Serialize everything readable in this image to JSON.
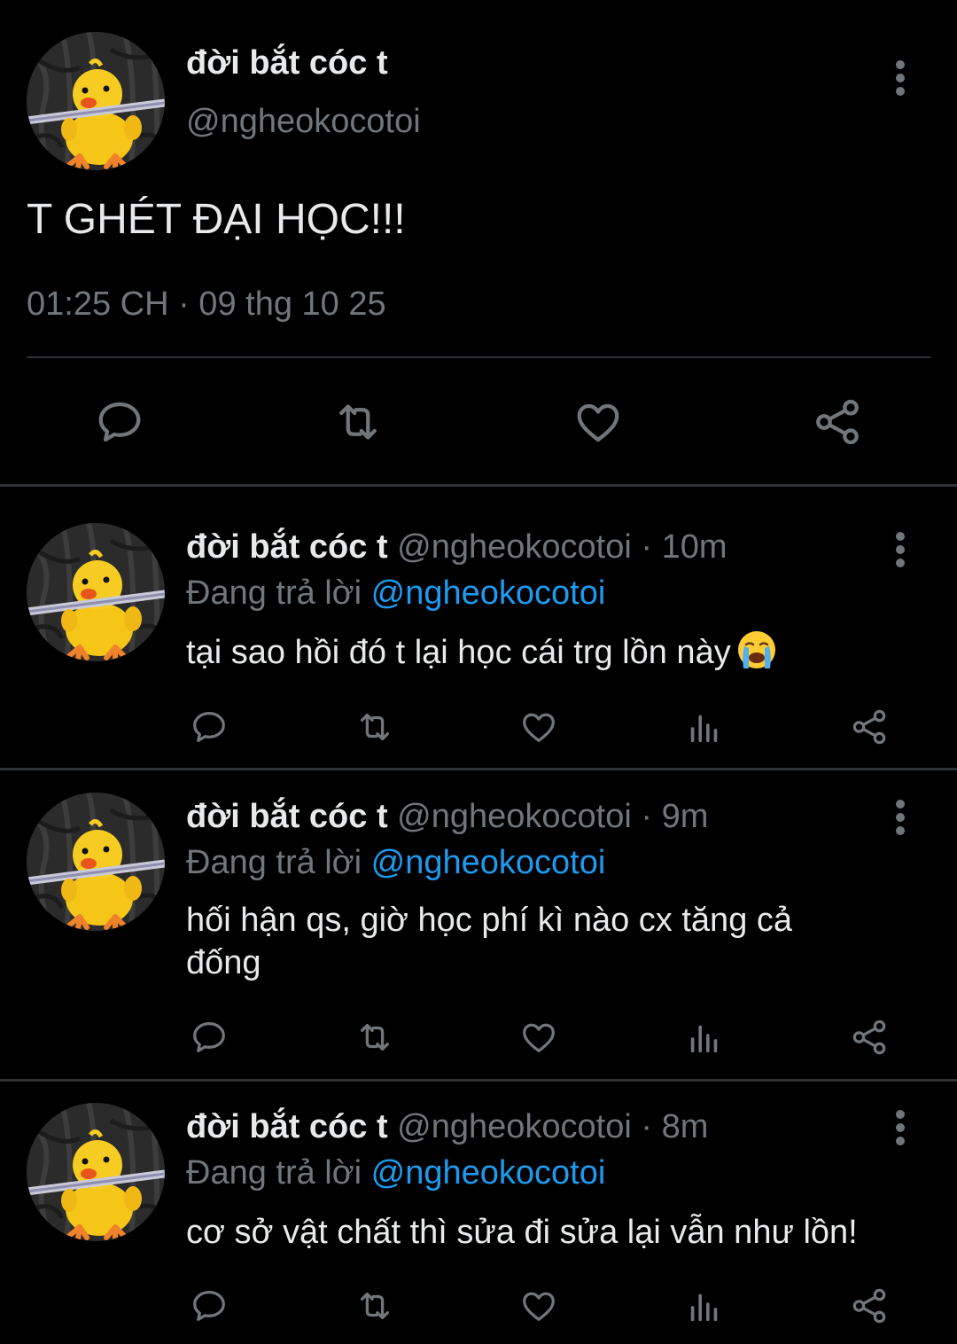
{
  "main_tweet": {
    "display_name": "đời bắt cóc t",
    "handle": "@ngheokocotoi",
    "text": "T GHÉT ĐẠI HỌC!!!",
    "timestamp": "01:25 CH · 09 thg 10 25",
    "avatar_icon": "duck-plush-avatar-icon",
    "actions": [
      "reply-icon",
      "retweet-icon",
      "like-icon",
      "share-icon"
    ]
  },
  "replies": [
    {
      "display_name": "đời bắt cóc t",
      "handle": "@ngheokocotoi",
      "separator": "·",
      "time_ago": "10m",
      "replying_prefix": "Đang trả lời",
      "replying_to": "@ngheokocotoi",
      "text": "tại sao hồi đó t lại học cái trg lồn này",
      "emoji": "loudly-crying-face-icon"
    },
    {
      "display_name": "đời bắt cóc t",
      "handle": "@ngheokocotoi",
      "separator": "·",
      "time_ago": "9m",
      "replying_prefix": "Đang trả lời",
      "replying_to": "@ngheokocotoi",
      "text": "hối hận qs, giờ học phí kì nào cx tăng cả đống"
    },
    {
      "display_name": "đời bắt cóc t",
      "handle": "@ngheokocotoi",
      "separator": "·",
      "time_ago": "8m",
      "replying_prefix": "Đang trả lời",
      "replying_to": "@ngheokocotoi",
      "text": "cơ sở vật chất thì sửa đi sửa lại vẫn như lồn!"
    }
  ],
  "colors": {
    "background": "#000000",
    "primary_text": "#e7e9ea",
    "secondary_text": "#71767b",
    "mention": "#1d9bf0",
    "divider": "#2f3336"
  }
}
